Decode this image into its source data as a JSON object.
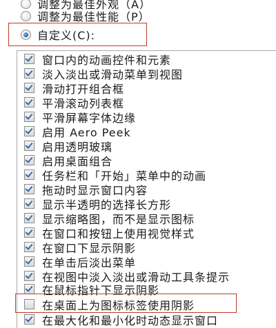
{
  "options": [
    {
      "label": "调整为最佳外观（A）",
      "selected": false
    },
    {
      "label": "调整为最佳性能（P）",
      "selected": false
    },
    {
      "label": "自定义(C):",
      "selected": true
    }
  ],
  "effects": [
    {
      "label": "窗口内的动画控件和元素",
      "checked": true
    },
    {
      "label": "淡入淡出或滑动菜单到视图",
      "checked": true
    },
    {
      "label": "滑动打开组合框",
      "checked": true
    },
    {
      "label": "平滑滚动列表框",
      "checked": true
    },
    {
      "label": "平滑屏幕字体边缘",
      "checked": true
    },
    {
      "label": "启用 Aero Peek",
      "checked": true
    },
    {
      "label": "启用透明玻璃",
      "checked": true
    },
    {
      "label": "启用桌面组合",
      "checked": true
    },
    {
      "label": "任务栏和「开始」菜单中的动画",
      "checked": true
    },
    {
      "label": "拖动时显示窗口内容",
      "checked": true
    },
    {
      "label": "显示半透明的选择长方形",
      "checked": true
    },
    {
      "label": "显示缩略图，而不是显示图标",
      "checked": true
    },
    {
      "label": "在窗口和按钮上使用视觉样式",
      "checked": true
    },
    {
      "label": "在窗口下显示阴影",
      "checked": true
    },
    {
      "label": "在单击后淡出菜单",
      "checked": true
    },
    {
      "label": "在视图中淡入淡出或滑动工具条提示",
      "checked": true
    },
    {
      "label": "在鼠标指针下显示阴影",
      "checked": true
    },
    {
      "label": "在桌面上为图标标签使用阴影",
      "checked": false
    },
    {
      "label": "在最大化和最小化时动态显示窗口",
      "checked": true
    }
  ],
  "highlight_color": "#c0392b",
  "checkmark_color": "#3a67a8"
}
